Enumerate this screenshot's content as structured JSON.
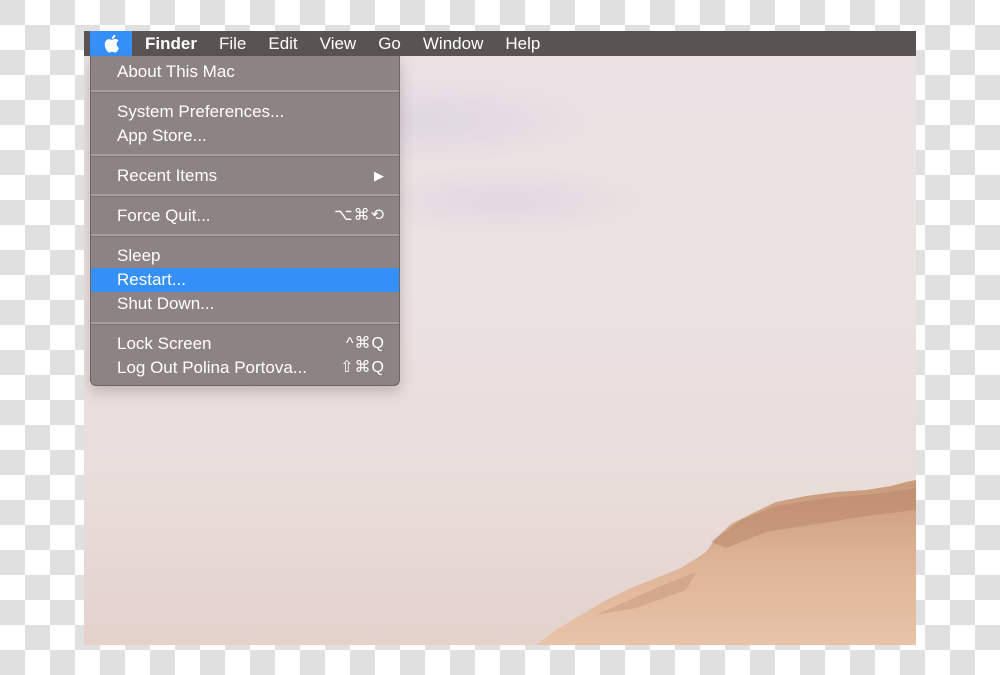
{
  "menubar": {
    "apple_icon": "apple-logo-icon",
    "items": [
      {
        "label": "Finder",
        "bold": true
      },
      {
        "label": "File"
      },
      {
        "label": "Edit"
      },
      {
        "label": "View"
      },
      {
        "label": "Go"
      },
      {
        "label": "Window"
      },
      {
        "label": "Help"
      }
    ]
  },
  "apple_menu": {
    "about": {
      "label": "About This Mac"
    },
    "system_preferences": {
      "label": "System Preferences..."
    },
    "app_store": {
      "label": "App Store..."
    },
    "recent_items": {
      "label": "Recent Items",
      "submenu_icon": "▶"
    },
    "force_quit": {
      "label": "Force Quit...",
      "shortcut": "⌥⌘⟲"
    },
    "sleep": {
      "label": "Sleep"
    },
    "restart": {
      "label": "Restart...",
      "highlighted": true
    },
    "shut_down": {
      "label": "Shut Down..."
    },
    "lock_screen": {
      "label": "Lock Screen",
      "shortcut": "^⌘Q"
    },
    "log_out": {
      "label": "Log Out Polina Portova...",
      "shortcut": "⇧⌘Q"
    }
  },
  "colors": {
    "highlight": "#3490f7",
    "menubar": "#595354",
    "menu_bg": "#8c8382"
  }
}
